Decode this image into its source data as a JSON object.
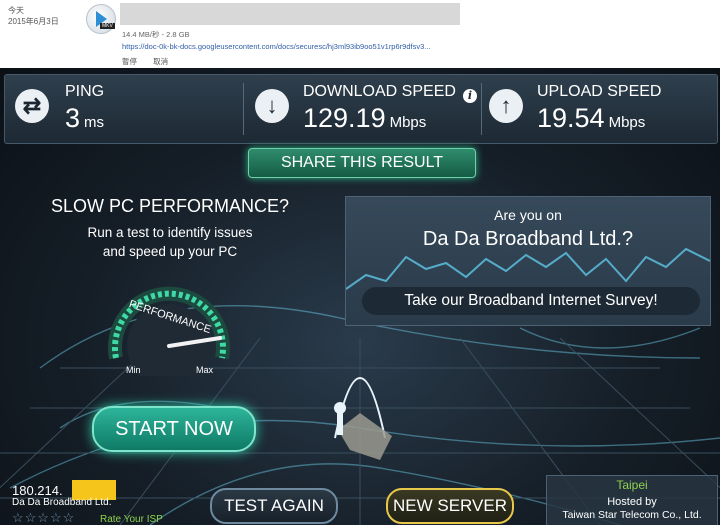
{
  "download": {
    "day": "今天",
    "date": "2015年6月3日",
    "size": "14.4 MB/秒 - 2.8 GB",
    "url": "https://doc-0k-bk-docs.googleusercontent.com/docs/securesc/hj3ml93ib9oo51v1rp6r9dfsv3...",
    "pause_label": "暫停",
    "cancel_label": "取消",
    "icon_tag": "MKV"
  },
  "stats": {
    "ping": {
      "label": "PING",
      "value": "3",
      "unit": "ms"
    },
    "download": {
      "label": "DOWNLOAD SPEED",
      "value": "129.19",
      "unit": "Mbps"
    },
    "upload": {
      "label": "UPLOAD SPEED",
      "value": "19.54",
      "unit": "Mbps"
    }
  },
  "share_label": "SHARE THIS RESULT",
  "promo": {
    "title": "SLOW PC PERFORMANCE?",
    "line1": "Run a test to identify issues",
    "line2": "and speed up your PC",
    "gauge_label": "PERFORMANCE",
    "gauge_min": "Min",
    "gauge_max": "Max",
    "start_label": "START NOW"
  },
  "survey": {
    "question": "Are you on",
    "isp": "Da Da Broadband Ltd.?",
    "button": "Take our Broadband Internet Survey!"
  },
  "footer": {
    "ip": "180.214.",
    "isp": "Da Da Broadband Ltd.",
    "rate_label": "Rate Your ISP",
    "stars": "☆☆☆☆☆",
    "test_again": "TEST AGAIN",
    "new_server": "NEW SERVER",
    "city": "Taipei",
    "hosted_by": "Hosted by",
    "host": "Taiwan Star Telecom Co., Ltd."
  },
  "colors": {
    "accent_green": "#2db59a",
    "server_gold": "#e8c84a",
    "city_green": "#8fd14f"
  }
}
